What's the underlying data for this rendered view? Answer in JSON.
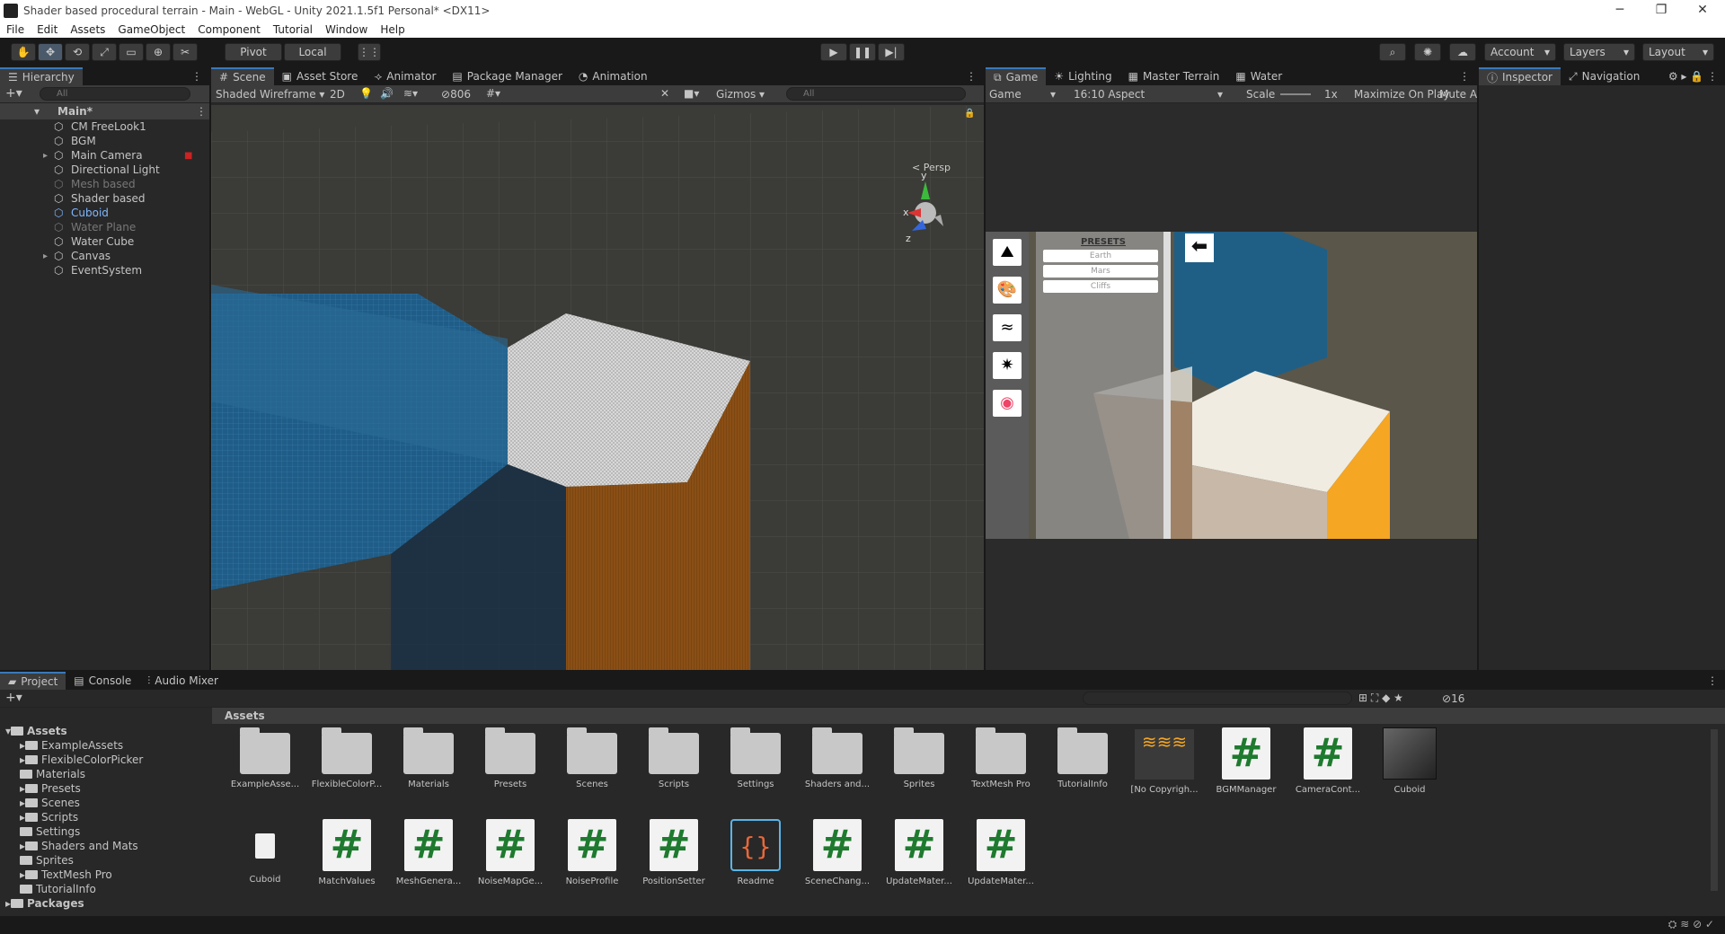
{
  "window": {
    "title": "Shader based procedural terrain - Main - WebGL - Unity 2021.1.5f1 Personal* <DX11>"
  },
  "menu": [
    "File",
    "Edit",
    "Assets",
    "GameObject",
    "Component",
    "Tutorial",
    "Window",
    "Help"
  ],
  "toolbar": {
    "pivot": "Pivot",
    "local": "Local",
    "account": "Account",
    "layers": "Layers",
    "layout": "Layout"
  },
  "hierarchy": {
    "tab": "Hierarchy",
    "search_placeholder": "All",
    "root": "Main*",
    "items": [
      {
        "label": "CM FreeLook1",
        "state": "normal"
      },
      {
        "label": "BGM",
        "state": "normal"
      },
      {
        "label": "Main Camera",
        "state": "normal"
      },
      {
        "label": "Directional Light",
        "state": "normal"
      },
      {
        "label": "Mesh based",
        "state": "disabled"
      },
      {
        "label": "Shader based",
        "state": "normal"
      },
      {
        "label": "Cuboid",
        "state": "prefab"
      },
      {
        "label": "Water Plane",
        "state": "disabled"
      },
      {
        "label": "Water Cube",
        "state": "normal"
      },
      {
        "label": "Canvas",
        "state": "normal"
      },
      {
        "label": "EventSystem",
        "state": "normal"
      }
    ]
  },
  "scene_tabs": [
    "Scene",
    "Asset Store",
    "Animator",
    "Package Manager",
    "Animation"
  ],
  "scene_bar": {
    "draw_mode": "Shaded Wireframe",
    "mode_2d": "2D",
    "hidden_count": "806",
    "gizmos": "Gizmos",
    "search_placeholder": "All",
    "persp": "< Persp"
  },
  "game_tabs": [
    "Game",
    "Lighting",
    "Master Terrain",
    "Water"
  ],
  "game_bar": {
    "display": "Game",
    "aspect": "16:10 Aspect",
    "scale_label": "Scale",
    "scale_value": "1x",
    "maximize": "Maximize On Play",
    "mute": "Mute Aud"
  },
  "game_ui": {
    "presets_title": "PRESETS",
    "presets": [
      "Earth",
      "Mars",
      "Cliffs"
    ]
  },
  "inspector_tabs": [
    "Inspector",
    "Navigation"
  ],
  "bottom_tabs": [
    "Project",
    "Console",
    "Audio Mixer"
  ],
  "project": {
    "breadcrumb": "Assets",
    "hidden_count": "16",
    "tree": [
      {
        "label": "Assets",
        "level": 0
      },
      {
        "label": "ExampleAssets",
        "level": 1
      },
      {
        "label": "FlexibleColorPicker",
        "level": 1
      },
      {
        "label": "Materials",
        "level": 1
      },
      {
        "label": "Presets",
        "level": 1
      },
      {
        "label": "Scenes",
        "level": 1
      },
      {
        "label": "Scripts",
        "level": 1
      },
      {
        "label": "Settings",
        "level": 1
      },
      {
        "label": "Shaders and Mats",
        "level": 1
      },
      {
        "label": "Sprites",
        "level": 1
      },
      {
        "label": "TextMesh Pro",
        "level": 1
      },
      {
        "label": "TutorialInfo",
        "level": 1
      },
      {
        "label": "Packages",
        "level": 0
      }
    ],
    "assets_row1": [
      {
        "label": "ExampleAsse...",
        "kind": "folder"
      },
      {
        "label": "FlexibleColorP...",
        "kind": "folder"
      },
      {
        "label": "Materials",
        "kind": "folder"
      },
      {
        "label": "Presets",
        "kind": "folder"
      },
      {
        "label": "Scenes",
        "kind": "folder"
      },
      {
        "label": "Scripts",
        "kind": "folder"
      },
      {
        "label": "Settings",
        "kind": "folder"
      },
      {
        "label": "Shaders and...",
        "kind": "folder"
      },
      {
        "label": "Sprites",
        "kind": "folder"
      },
      {
        "label": "TextMesh Pro",
        "kind": "folder"
      },
      {
        "label": "TutorialInfo",
        "kind": "folder"
      },
      {
        "label": "[No Copyrigh...",
        "kind": "audio"
      },
      {
        "label": "BGMManager",
        "kind": "script"
      },
      {
        "label": "CameraCont...",
        "kind": "script"
      },
      {
        "label": "Cuboid",
        "kind": "prefab"
      }
    ],
    "assets_row2": [
      {
        "label": "Cuboid",
        "kind": "file"
      },
      {
        "label": "MatchValues",
        "kind": "script"
      },
      {
        "label": "MeshGenera...",
        "kind": "script"
      },
      {
        "label": "NoiseMapGe...",
        "kind": "script"
      },
      {
        "label": "NoiseProfile",
        "kind": "script"
      },
      {
        "label": "PositionSetter",
        "kind": "script"
      },
      {
        "label": "Readme",
        "kind": "readme"
      },
      {
        "label": "SceneChang...",
        "kind": "script"
      },
      {
        "label": "UpdateMater...",
        "kind": "script"
      },
      {
        "label": "UpdateMater...",
        "kind": "script"
      }
    ]
  },
  "colors": {
    "accent": "#3a79bb",
    "water": "#1e5f8c",
    "orange": "#f5a623",
    "script_green": "#1e7a2e"
  }
}
